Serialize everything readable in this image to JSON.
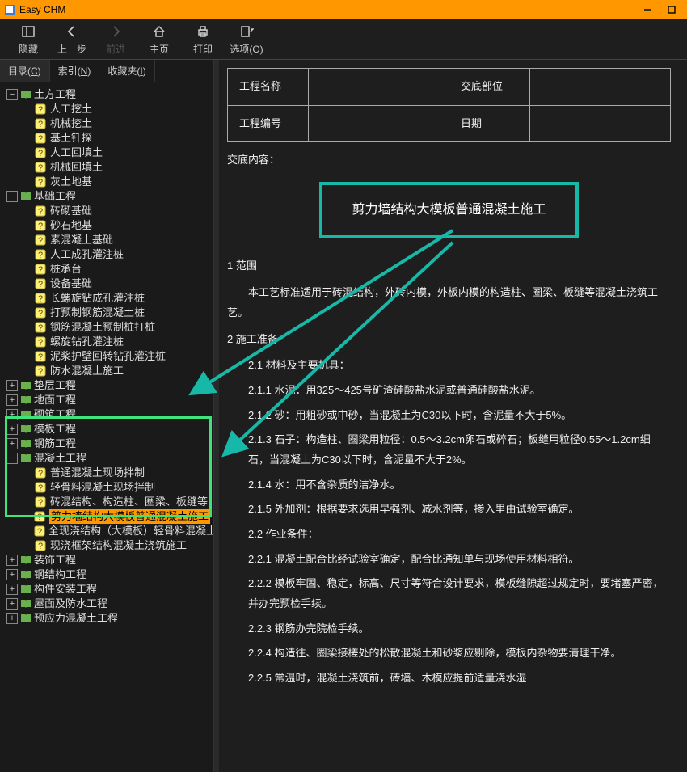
{
  "window": {
    "title": "Easy CHM"
  },
  "toolbar": {
    "hide": "隐藏",
    "back": "上一步",
    "forward": "前进",
    "home": "主页",
    "print": "打印",
    "options": "选项(O)"
  },
  "tabs": {
    "contents_pre": "目录(",
    "contents_key": "C",
    "contents_post": ")",
    "index_pre": "索引(",
    "index_key": "N",
    "index_post": ")",
    "fav_pre": "收藏夹(",
    "fav_key": "I",
    "fav_post": ")"
  },
  "tree": {
    "g0": {
      "label": "土方工程",
      "expanded": true,
      "children": [
        "人工挖土",
        "机械挖土",
        "基土钎探",
        "人工回填土",
        "机械回填土",
        "灰土地基"
      ]
    },
    "g1": {
      "label": "基础工程",
      "expanded": true,
      "children": [
        "砖砌基础",
        "砂石地基",
        "素混凝土基础",
        "人工成孔灌注桩",
        "桩承台",
        "设备基础",
        "长螺旋钻成孔灌注桩",
        "打预制钢筋混凝土桩",
        "钢筋混凝土预制桩打桩",
        "螺旋钻孔灌注桩",
        "泥浆护壁回转钻孔灌注桩",
        "防水混凝土施工"
      ]
    },
    "g2": {
      "label": "垫层工程",
      "expanded": false
    },
    "g3": {
      "label": "地面工程",
      "expanded": false
    },
    "g4": {
      "label": "砌筑工程",
      "expanded": false
    },
    "g5": {
      "label": "模板工程",
      "expanded": false
    },
    "g6": {
      "label": "钢筋工程",
      "expanded": false
    },
    "g7": {
      "label": "混凝土工程",
      "expanded": true,
      "children": [
        "普通混凝土现场拌制",
        "轻骨料混凝土现场拌制",
        "砖混结构、构造柱、圈梁、板缝等",
        "剪力墙结构大模板普通混凝土施工",
        "全现浇结构（大模板）轻骨料混凝土",
        "现浇框架结构混凝土浇筑施工"
      ],
      "selected_index": 3
    },
    "g8": {
      "label": "装饰工程",
      "expanded": false
    },
    "g9": {
      "label": "钢结构工程",
      "expanded": false
    },
    "g10": {
      "label": "构件安装工程",
      "expanded": false
    },
    "g11": {
      "label": "屋面及防水工程",
      "expanded": false
    },
    "g12": {
      "label": "预应力混凝土工程",
      "expanded": false
    }
  },
  "doc": {
    "info": {
      "row1a": "工程名称",
      "row1b": "",
      "row1c": "交底部位",
      "row1d": "",
      "row2a": "工程编号",
      "row2b": "",
      "row2c": "日期",
      "row2d": ""
    },
    "section_label": "交底内容：",
    "title": "剪力墙结构大模板普通混凝土施工",
    "scope_head": "1    范围",
    "scope_body": "本工艺标准适用于砖混结构，外砖内模，外板内模的构造柱、圈梁、板缝等混凝土浇筑工艺。",
    "prep_head": "2    施工准备",
    "items": {
      "i21": "2.1    材料及主要机具：",
      "i211": "2.1.1    水泥：用325～425号矿渣硅酸盐水泥或普通硅酸盐水泥。",
      "i212": "2.1.2    砂：用粗砂或中砂，当混凝土为C30以下时，含泥量不大于5%。",
      "i213": "2.1.3    石子：构造柱、圈梁用粒径：0.5～3.2cm卵石或碎石；板缝用粒径0.55～1.2cm细石，当混凝土为C30以下时，含泥量不大于2%。",
      "i214": "2.1.4    水：用不含杂质的洁净水。",
      "i215": "2.1.5    外加剂：根据要求选用早强剂、减水剂等，掺入里由试验室确定。",
      "i22": "2.2    作业条件：",
      "i221": "2.2.1    混凝土配合比经试验室确定，配合比通知单与现场使用材料相符。",
      "i222": "2.2.2    模板牢固、稳定，标高、尺寸等符合设计要求，模板缝隙超过规定时，要堵塞严密，并办完预检手续。",
      "i223": "2.2.3    钢筋办完院检手续。",
      "i224": "2.2.4    构造往、圈梁接槎处的松散混凝土和砂浆应剔除，模板内杂物要清理干净。",
      "i225": "2.2.5    常温时，混凝土浇筑前，砖墙、木模应提前适量浇水湿"
    }
  }
}
